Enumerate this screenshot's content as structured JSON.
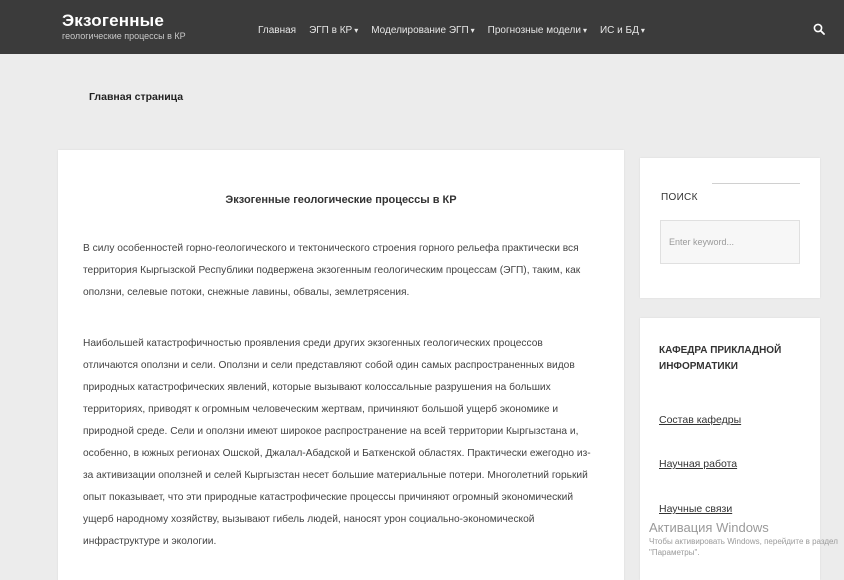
{
  "header": {
    "site_title": "Экзогенные",
    "site_subtitle": "геологические процессы в КР",
    "nav": [
      {
        "label": "Главная",
        "has_dropdown": false
      },
      {
        "label": "ЭГП в КР",
        "has_dropdown": true
      },
      {
        "label": "Моделирование ЭГП",
        "has_dropdown": true
      },
      {
        "label": "Прогнозные модели",
        "has_dropdown": true
      },
      {
        "label": "ИС и БД",
        "has_dropdown": true
      }
    ],
    "search_icon": "search-icon"
  },
  "breadcrumb": "Главная страница",
  "article": {
    "title": "Экзогенные геологические процессы в КР",
    "paragraphs": [
      "В силу особенностей горно-геологического и тектонического строения горного рельефа практически вся территория Кыргызской Республики подвержена экзогенным геологическим процессам (ЭГП), таким, как оползни, селевые потоки, снежные лавины, обвалы, землетрясения.",
      "Наибольшей катастрофичностью проявления среди других экзогенных геологических процессов отличаются оползни и сели. Оползни и сели представляют собой один самых распространенных видов природных катастрофических явлений, которые вызывают колоссальные разрушения на больших территориях, приводят к огромным человеческим жертвам, причиняют большой ущерб экономике и природной среде. Сели и оползни имеют широкое распространение на всей территории Кыргызстана и, особенно, в южных регионах Ошской, Джалал-Абадской и Баткенской областях. Практически ежегодно из-за активизации оползней и селей Кыргызстан несет большие материальные потери. Многолетний горький опыт показывает, что эти природные катастрофические процессы причиняют огромный экономический ущерб народному хозяйству, вызывают гибель людей, наносят урон социально-экономической инфраструктуре и экологии."
    ]
  },
  "sidebar": {
    "search_widget": {
      "title": "ПОИСК",
      "placeholder": "Enter keyword..."
    },
    "department_widget": {
      "title": "КАФЕДРА ПРИКЛАДНОЙ ИНФОРМАТИКИ",
      "links": [
        "Состав кафедры",
        "Научная работа",
        "Научные связи"
      ]
    }
  },
  "os_overlay": {
    "title": "Активация Windows",
    "subtitle": "Чтобы активировать Windows, перейдите в раздел \"Параметры\"."
  },
  "colors": {
    "header_bg": "#3b3b3b",
    "page_bg": "#ececec",
    "card_bg": "#ffffff"
  }
}
